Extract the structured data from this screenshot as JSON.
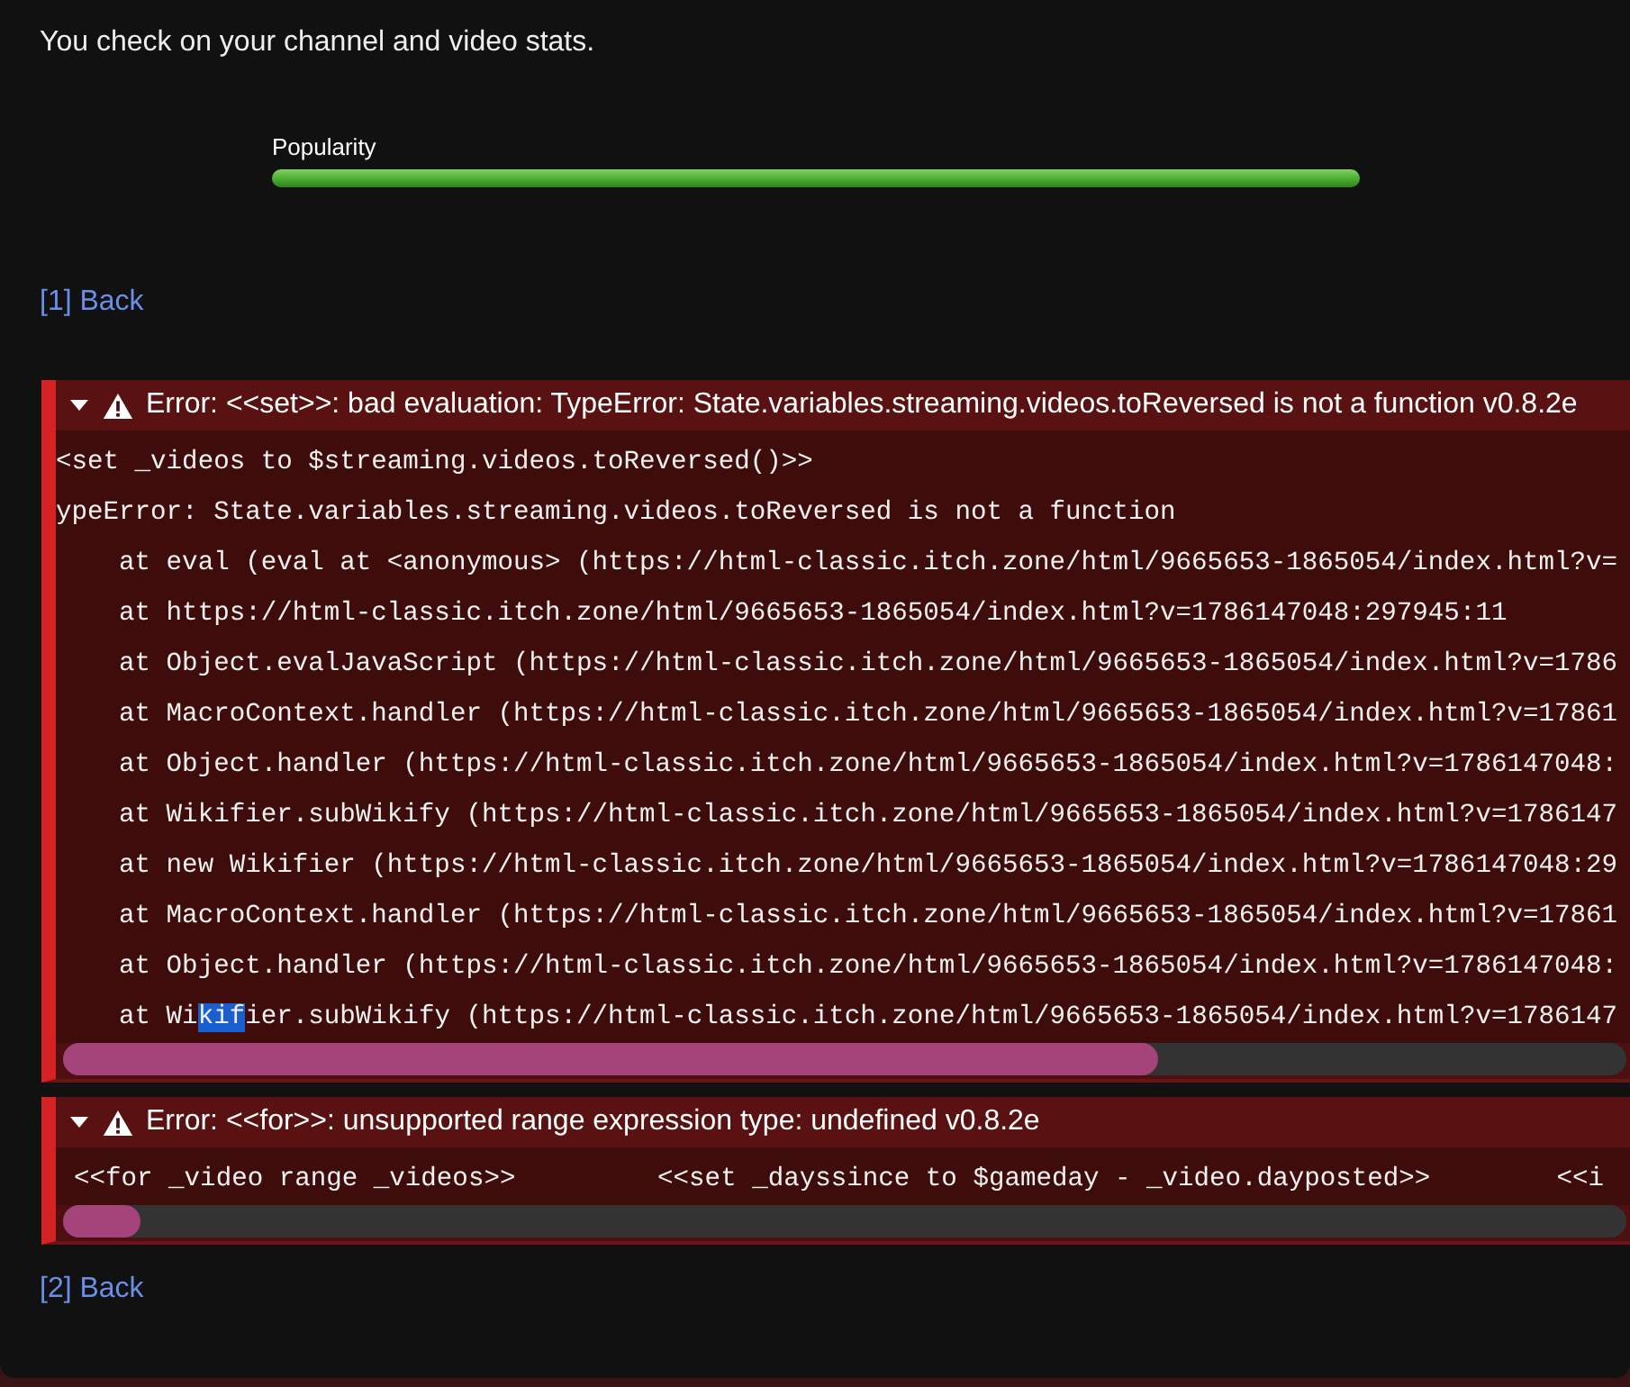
{
  "intro": "You check on your channel and video stats.",
  "meters": [
    {
      "label": "Popularity",
      "level": 1.0
    }
  ],
  "links": [
    {
      "text": "[1] Back"
    }
  ],
  "errors": [
    {
      "title": "Error: <<set>>: bad evaluation: TypeError: State.variables.streaming.videos.toReversed is not a function v0.8.2e",
      "expanded": true,
      "lines": [
        {
          "segments": [
            {
              "text": "<set _videos to $streaming.videos.toReversed()>>",
              "selected": false
            }
          ]
        },
        {
          "segments": [
            {
              "text": "ypeError: State.variables.streaming.videos.toReversed is not a function",
              "selected": false
            }
          ]
        },
        {
          "segments": [
            {
              "text": "    at eval (eval at <anonymous> (https://html-classic.itch.zone/html/9665653-1865054/index.html?v=",
              "selected": false
            }
          ]
        },
        {
          "segments": [
            {
              "text": "    at https://html-classic.itch.zone/html/9665653-1865054/index.html?v=1786147048:297945:11",
              "selected": false
            }
          ]
        },
        {
          "segments": [
            {
              "text": "    at Object.evalJavaScript (https://html-classic.itch.zone/html/9665653-1865054/index.html?v=1786",
              "selected": false
            }
          ]
        },
        {
          "segments": [
            {
              "text": "    at MacroContext.handler (https://html-classic.itch.zone/html/9665653-1865054/index.html?v=17861",
              "selected": false
            }
          ]
        },
        {
          "segments": [
            {
              "text": "    at Object.handler (https://html-classic.itch.zone/html/9665653-1865054/index.html?v=1786147048:",
              "selected": false
            }
          ]
        },
        {
          "segments": [
            {
              "text": "    at Wikifier.subWikify (https://html-classic.itch.zone/html/9665653-1865054/index.html?v=1786147",
              "selected": false
            }
          ]
        },
        {
          "segments": [
            {
              "text": "    at new Wikifier (https://html-classic.itch.zone/html/9665653-1865054/index.html?v=1786147048:29",
              "selected": false
            }
          ]
        },
        {
          "segments": [
            {
              "text": "    at MacroContext.handler (https://html-classic.itch.zone/html/9665653-1865054/index.html?v=17861",
              "selected": false
            }
          ]
        },
        {
          "segments": [
            {
              "text": "    at Object.handler (https://html-classic.itch.zone/html/9665653-1865054/index.html?v=1786147048:",
              "selected": false
            }
          ]
        },
        {
          "segments": [
            {
              "text": "    at Wi",
              "selected": false
            },
            {
              "text": "kif",
              "selected": true
            },
            {
              "text": "ier.subWikify (https://html-classic.itch.zone/html/9665653-1865054/index.html?v=1786147",
              "selected": false
            }
          ]
        }
      ]
    },
    {
      "title": "Error: <<for>>: unsupported range expression type: undefined v0.8.2e",
      "expanded": true,
      "lines": [
        {
          "segments": [
            {
              "text": "<<for _video range _videos>>         <<set _dayssince to $gameday - _video.dayposted>>        <<i",
              "selected": false
            }
          ]
        }
      ]
    }
  ],
  "footer_links": [
    {
      "text": "[2] Back"
    }
  ]
}
